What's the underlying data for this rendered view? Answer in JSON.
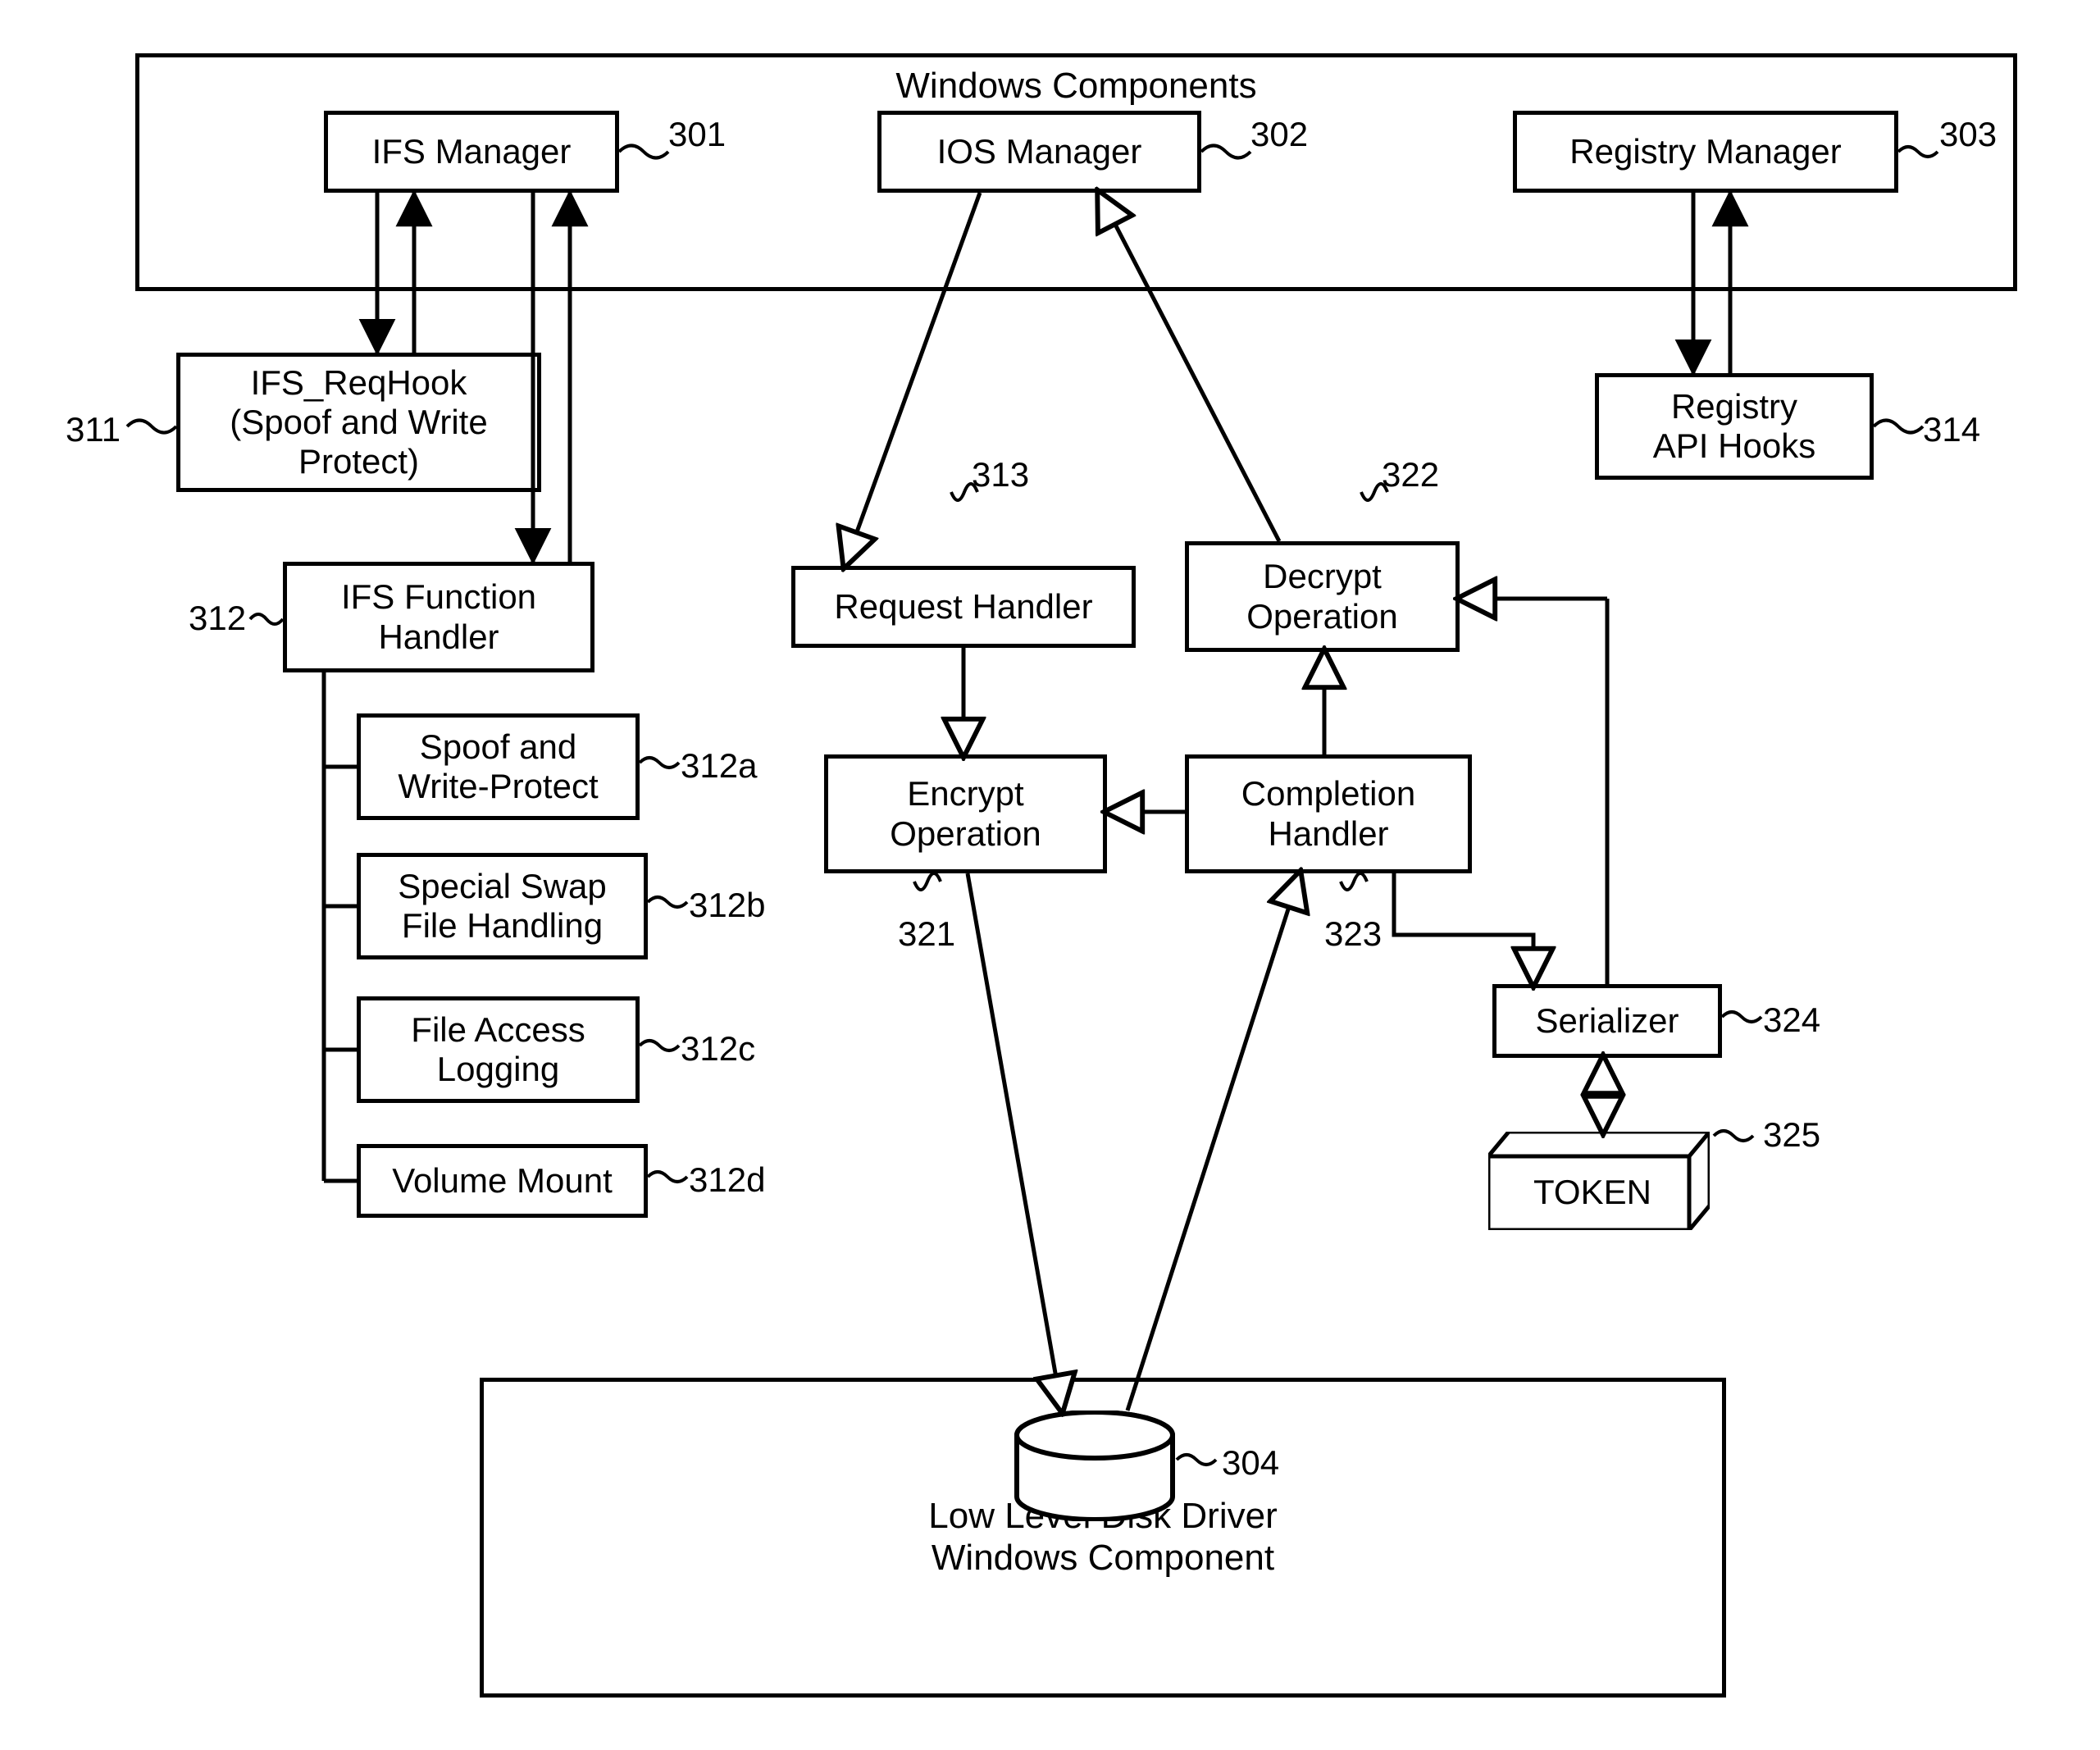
{
  "top_container_title": "Windows Components",
  "bottom_container_line1": "Low Level Disk Driver",
  "bottom_container_line2": "Windows Component",
  "boxes": {
    "ifs_manager": "IFS Manager",
    "ios_manager": "IOS Manager",
    "registry_manager": "Registry Manager",
    "ifs_reqhook_l1": "IFS_ReqHook",
    "ifs_reqhook_l2": "(Spoof and Write",
    "ifs_reqhook_l3": "Protect)",
    "registry_api_l1": "Registry",
    "registry_api_l2": "API Hooks",
    "ifs_func_l1": "IFS Function",
    "ifs_func_l2": "Handler",
    "spoof_wp_l1": "Spoof and",
    "spoof_wp_l2": "Write-Protect",
    "swap_l1": "Special Swap",
    "swap_l2": "File Handling",
    "fal_l1": "File Access",
    "fal_l2": "Logging",
    "vol_mount": "Volume Mount",
    "request_handler": "Request Handler",
    "decrypt_l1": "Decrypt",
    "decrypt_l2": "Operation",
    "encrypt_l1": "Encrypt",
    "encrypt_l2": "Operation",
    "completion_l1": "Completion",
    "completion_l2": "Handler",
    "serializer": "Serializer",
    "token": "TOKEN"
  },
  "refs": {
    "r301": "301",
    "r302": "302",
    "r303": "303",
    "r304": "304",
    "r311": "311",
    "r312": "312",
    "r312a": "312a",
    "r312b": "312b",
    "r312c": "312c",
    "r312d": "312d",
    "r313": "313",
    "r314": "314",
    "r321": "321",
    "r322": "322",
    "r323": "323",
    "r324": "324",
    "r325": "325"
  }
}
